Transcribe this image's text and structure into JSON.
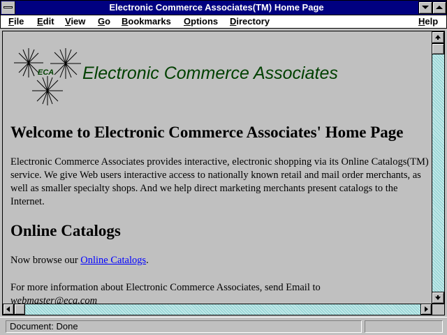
{
  "window": {
    "title": "Electronic Commerce Associates(TM) Home Page"
  },
  "menu": [
    {
      "label": "File"
    },
    {
      "label": "Edit"
    },
    {
      "label": "View"
    },
    {
      "label": "Go"
    },
    {
      "label": "Bookmarks"
    },
    {
      "label": "Options"
    },
    {
      "label": "Directory"
    },
    {
      "label": "Help"
    }
  ],
  "page": {
    "logo_text": "ECA",
    "brand_name": "Electronic Commerce Associates",
    "heading": "Welcome to Electronic Commerce Associates' Home Page",
    "intro": "Electronic Commerce Associates provides interactive, electronic shopping via its Online Catalogs(TM) service. We give Web users interactive access to nationally known retail and mail order merchants, as well as smaller specialty shops. And we help direct marketing merchants present catalogs to the Internet.",
    "section_heading": "Online Catalogs",
    "browse_prefix": "Now browse our ",
    "browse_link": "Online Catalogs",
    "browse_suffix": ".",
    "info_text": "For more information about Electronic Commerce Associates, send Email to",
    "email": "webmaster@eca.com"
  },
  "status": {
    "text": "Document: Done"
  },
  "colors": {
    "titlebar": "#000080",
    "chrome": "#c0c0c0",
    "link": "#0000ff",
    "brand": "#004000"
  }
}
